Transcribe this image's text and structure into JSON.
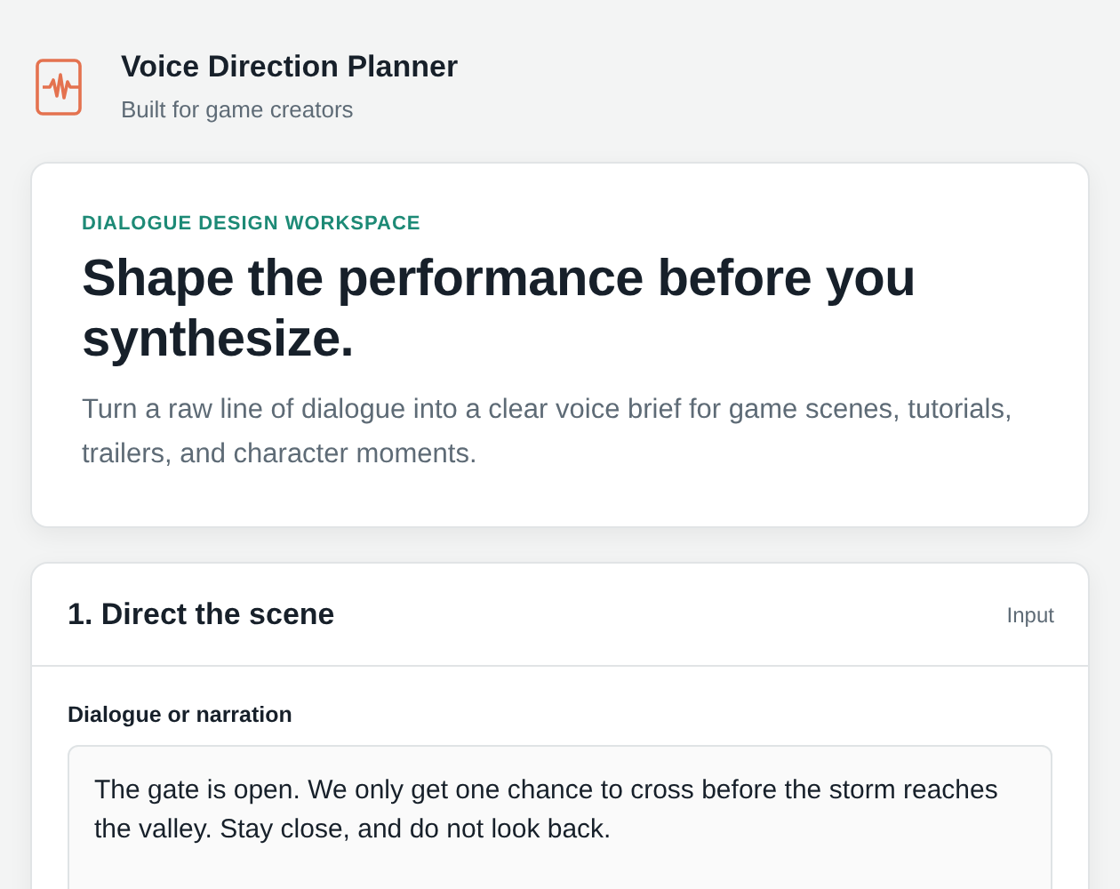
{
  "app": {
    "title": "Voice Direction Planner",
    "subtitle": "Built for game creators"
  },
  "hero": {
    "eyebrow": "DIALOGUE DESIGN WORKSPACE",
    "heading": "Shape the performance before you synthesize.",
    "description": "Turn a raw line of dialogue into a clear voice brief for game scenes, tutorials, trailers, and character moments."
  },
  "panel": {
    "title": "1. Direct the scene",
    "tag": "Input",
    "field": {
      "label": "Dialogue or narration",
      "value": "The gate is open. We only get one chance to cross before the storm reaches the valley. Stay close, and do not look back."
    }
  }
}
